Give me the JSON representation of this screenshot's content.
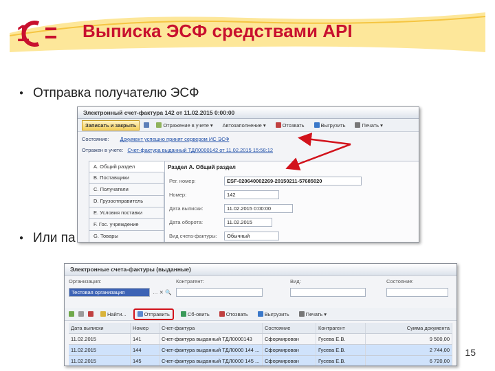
{
  "slide": {
    "title": "Выписка ЭСФ средствами API",
    "bullet1": "Отправка получателю ЭСФ",
    "bullet2": "Или па",
    "page_number": "15",
    "accent_color": "#c8102e"
  },
  "window1": {
    "title": "Электронный счет-фактура 142 от 11.02.2015 0:00:00",
    "toolbar": [
      "Записать и закрыть",
      "Отражение в учете",
      "Автозаполнение",
      "Отозвать",
      "Выгрузить",
      "Печать"
    ],
    "status_label": "Состояние:",
    "status_value": "Документ успешно принят сервером ИС ЭСФ",
    "reflected_label": "Отражен в учете:",
    "reflected_value": "Счет-фактура выданный ТДЛ0000142 от 11.02.2015 15:58:12",
    "nav": [
      "А. Общий раздел",
      "В. Поставщики",
      "С. Получатели",
      "D. Грузоотправитель",
      "Е. Условия поставки",
      "F. Гос. учреждение",
      "G. Товары"
    ],
    "section_title": "Раздел А. Общий раздел",
    "fields": [
      {
        "label": "Рег. номер:",
        "value": "ESF-020640002269-20150211-57685020"
      },
      {
        "label": "Номер:",
        "value": "142"
      },
      {
        "label": "Дата выписки:",
        "value": "11.02.2015 0:00:00"
      },
      {
        "label": "Дата оборота:",
        "value": "11.02.2015"
      },
      {
        "label": "Вид счета-фактуры:",
        "value": "Обычный"
      }
    ]
  },
  "window2": {
    "title": "Электронные счета-фактуры (выданные)",
    "org_label": "Организация:",
    "org_value": "Тестовая организация",
    "contractor_label": "Контрагент:",
    "kind_label": "Вид:",
    "state_label": "Состояние:",
    "toolbar": [
      "Найти...",
      "Отправить",
      "Сб-овить",
      "Отозвать",
      "Выгрузить",
      "Печать"
    ],
    "columns": [
      "Дата выписки",
      "Номер",
      "Счет-фактура",
      "Состояние",
      "Контрагент",
      "Сумма документа"
    ],
    "rows": [
      [
        "11.02.2015",
        "141",
        "Счет-фактура выданный ТДЛ0000143",
        "Сформирован",
        "Гусева Е.В.",
        "9 500,00"
      ],
      [
        "11.02.2015",
        "144",
        "Счет-фактура выданный ТДЛ0000 144 ...",
        "Сформирован",
        "Гусева Е.В.",
        "2 744,00"
      ],
      [
        "11.02.2015",
        "145",
        "Счет-фактура выданный ТДЛ0000 145 ...",
        "Сформирован",
        "Гусева Е.В.",
        "6 720,00"
      ]
    ]
  }
}
